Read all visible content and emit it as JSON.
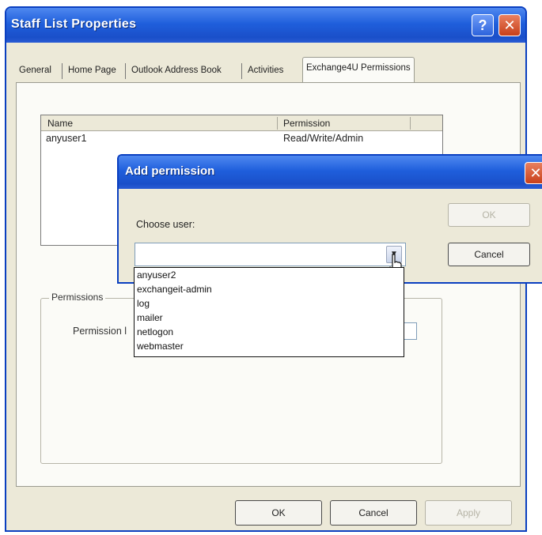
{
  "window": {
    "title": "Staff List Properties",
    "help_glyph": "?",
    "close_glyph": "✕"
  },
  "tabs": [
    {
      "label": "General"
    },
    {
      "label": "Home Page"
    },
    {
      "label": "Outlook Address Book"
    },
    {
      "label": "Activities"
    },
    {
      "label": "Exchange4U Permissions",
      "selected": true
    }
  ],
  "user_list": {
    "columns": [
      "Name",
      "Permission"
    ],
    "rows": [
      {
        "name": "anyuser1",
        "permission": "Read/Write/Admin"
      }
    ]
  },
  "permissions_group": {
    "legend": "Permissions",
    "level_label": "Permission l"
  },
  "buttons": {
    "ok": "OK",
    "cancel": "Cancel",
    "apply": "Apply"
  },
  "dialog": {
    "title": "Add permission",
    "close_glyph": "✕",
    "choose_user_label": "Choose user:",
    "combo_value": "",
    "dropdown_arrow": "▼",
    "ok_label": "OK",
    "cancel_label": "Cancel",
    "options": [
      "anyuser2",
      "exchangeit-admin",
      "log",
      "mailer",
      "netlogon",
      "webmaster"
    ]
  },
  "colors": {
    "titlebar": "#1f5fdc",
    "close_button": "#c8401a",
    "window_face": "#ece9d8"
  }
}
